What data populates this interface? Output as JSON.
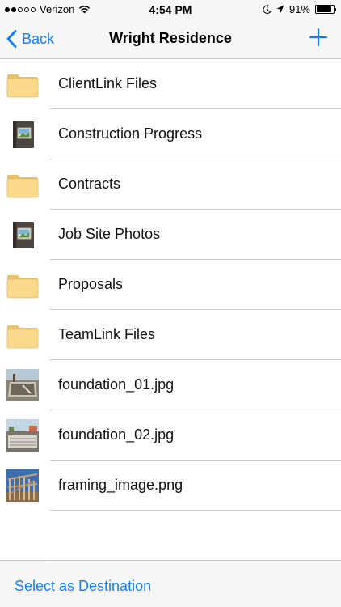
{
  "status_bar": {
    "carrier": "Verizon",
    "time": "4:54 PM",
    "battery_percent": "91%",
    "battery_level": 0.91,
    "signal_bars_filled": 2,
    "signal_bars_total": 5,
    "icons": [
      "wifi-icon",
      "moon-icon",
      "location-arrow-icon",
      "battery-icon"
    ]
  },
  "nav": {
    "back_label": "Back",
    "title": "Wright Residence",
    "add_icon": "plus-icon",
    "accent_color": "#147efb"
  },
  "files": [
    {
      "name": "ClientLink Files",
      "type": "folder"
    },
    {
      "name": "Construction Progress",
      "type": "album"
    },
    {
      "name": "Contracts",
      "type": "folder"
    },
    {
      "name": "Job Site Photos",
      "type": "album"
    },
    {
      "name": "Proposals",
      "type": "folder"
    },
    {
      "name": "TeamLink Files",
      "type": "folder"
    },
    {
      "name": "foundation_01.jpg",
      "type": "image"
    },
    {
      "name": "foundation_02.jpg",
      "type": "image"
    },
    {
      "name": "framing_image.png",
      "type": "image"
    }
  ],
  "toolbar": {
    "select_destination_label": "Select as Destination"
  }
}
